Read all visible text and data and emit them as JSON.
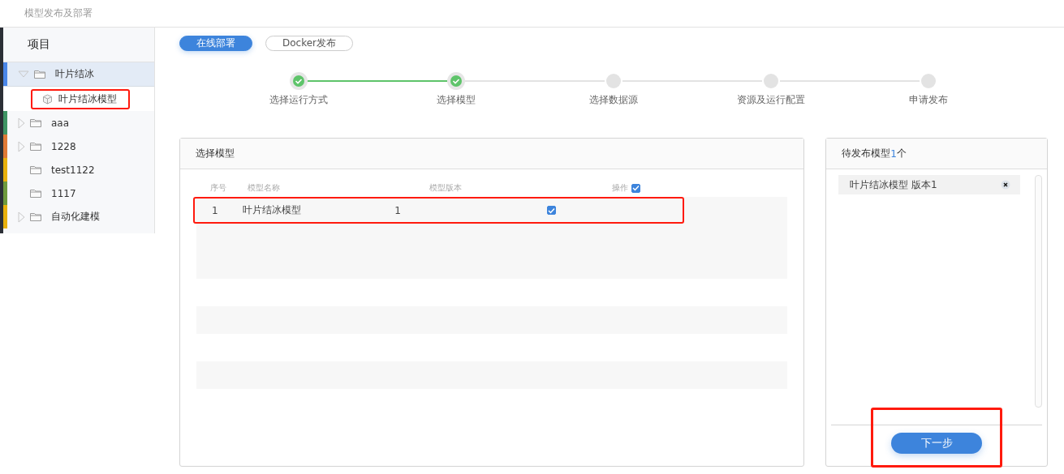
{
  "window": {
    "title": "模型发布及部署"
  },
  "sidebar": {
    "title": "项目",
    "items": [
      {
        "label": "叶片结冰",
        "kind": "folder",
        "expanded": true,
        "selected": true,
        "color": "#4a86e8",
        "children": [
          {
            "label": "叶片结冰模型",
            "kind": "model",
            "highlighted": true
          }
        ]
      },
      {
        "label": "aaa",
        "kind": "folder",
        "expanded": false,
        "selected": false,
        "color": "#3f9464"
      },
      {
        "label": "1228",
        "kind": "folder",
        "expanded": false,
        "selected": false,
        "color": "#e07a35"
      },
      {
        "label": "test1122",
        "kind": "folder",
        "selected": false,
        "color": "#e8b10c"
      },
      {
        "label": "1117",
        "kind": "folder",
        "selected": false,
        "color": "#6e9a3d"
      },
      {
        "label": "自动化建模",
        "kind": "folder",
        "expanded": false,
        "selected": false,
        "color": "#e8b10c"
      }
    ]
  },
  "mode_tabs": [
    {
      "label": "在线部署",
      "selected": true
    },
    {
      "label": "Docker发布",
      "selected": false
    }
  ],
  "steps": [
    {
      "label": "选择运行方式",
      "done": true
    },
    {
      "label": "选择模型",
      "done": true
    },
    {
      "label": "选择数据源",
      "done": false
    },
    {
      "label": "资源及运行配置",
      "done": false
    },
    {
      "label": "申请发布",
      "done": false
    }
  ],
  "model_panel": {
    "title": "选择模型",
    "columns": [
      "序号",
      "模型名称",
      "模型版本",
      "操作"
    ],
    "select_all": true,
    "rows": [
      {
        "index": "1",
        "name": "叶片结冰模型",
        "version": "1",
        "checked": true,
        "highlighted": true
      }
    ]
  },
  "pending_panel": {
    "title": "待发布模型",
    "count": "1",
    "unit": "个",
    "items": [
      {
        "label": "叶片结冰模型 版本1"
      }
    ],
    "next_button": {
      "label": "下一步",
      "highlighted": true
    }
  }
}
